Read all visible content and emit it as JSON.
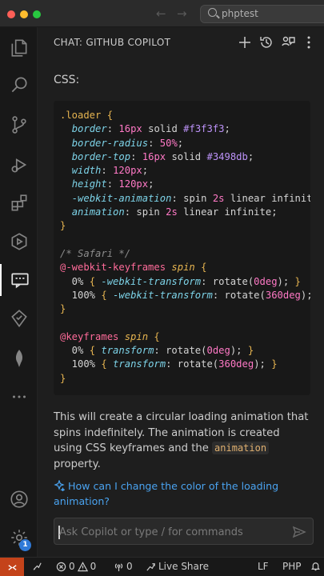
{
  "titlebar": {
    "traffic_colors": [
      "#ff5f57",
      "#febc2e",
      "#28c840"
    ],
    "back_icon": "arrow-left-icon",
    "forward_icon": "arrow-right-icon",
    "search_text": "phptest"
  },
  "activity_bar": {
    "items": [
      "explorer-icon",
      "search-icon",
      "source-control-icon",
      "run-debug-icon",
      "extensions-icon",
      "deploy-icon",
      "chat-icon",
      "copilot-icon",
      "leaf-icon",
      "more-icon"
    ],
    "active": "chat-icon",
    "bottom": [
      "accounts-icon",
      "settings-gear-icon"
    ],
    "settings_badge": "1"
  },
  "panel": {
    "title": "CHAT: GITHUB COPILOT",
    "header_icons": [
      "new-chat-icon",
      "history-icon",
      "chat-editor-icon",
      "more-actions-icon"
    ],
    "css_label": "CSS:",
    "paragraph_before": "This will create a circular loading animation that spins indefinitely. The animation is created using CSS keyframes and the ",
    "paragraph_code": "animation",
    "paragraph_after": " property.",
    "suggestion": "How can I change the color of the loading animation?",
    "input_placeholder": "Ask Copilot or type / for commands"
  },
  "statusbar": {
    "errors": "0",
    "warnings": "0",
    "ports": "0",
    "live_share": "Live Share",
    "eol": "LF",
    "language": "PHP"
  },
  "colors": {
    "accent_blue": "#4aa3f0",
    "remote_orange": "#c4431a",
    "badge_blue": "#2f7ad8"
  }
}
